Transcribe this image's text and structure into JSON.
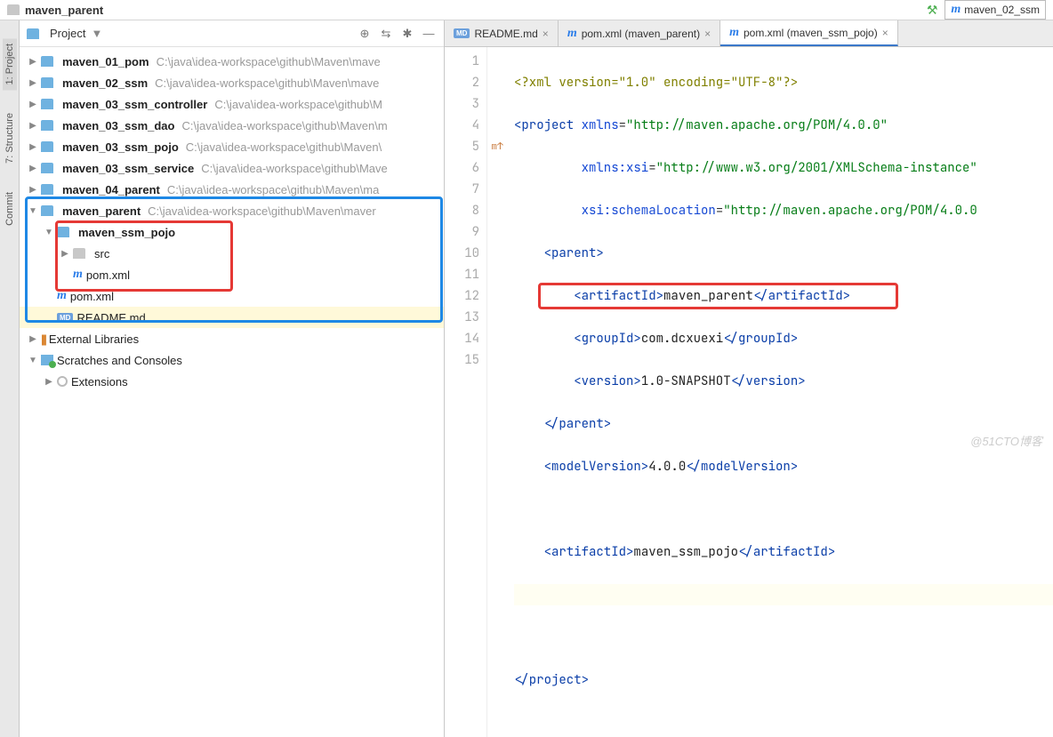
{
  "breadcrumb": {
    "folder": "maven_parent"
  },
  "run_config": "maven_02_ssm",
  "panel": {
    "title": "Project"
  },
  "tree": {
    "items": [
      {
        "name": "maven_01_pom",
        "path": "C:\\java\\idea-workspace\\github\\Maven\\mave",
        "bold": true
      },
      {
        "name": "maven_02_ssm",
        "path": "C:\\java\\idea-workspace\\github\\Maven\\mave",
        "bold": true
      },
      {
        "name": "maven_03_ssm_controller",
        "path": "C:\\java\\idea-workspace\\github\\M",
        "bold": true
      },
      {
        "name": "maven_03_ssm_dao",
        "path": "C:\\java\\idea-workspace\\github\\Maven\\m",
        "bold": true
      },
      {
        "name": "maven_03_ssm_pojo",
        "path": "C:\\java\\idea-workspace\\github\\Maven\\",
        "bold": true
      },
      {
        "name": "maven_03_ssm_service",
        "path": "C:\\java\\idea-workspace\\github\\Mave",
        "bold": true
      },
      {
        "name": "maven_04_parent",
        "path": "C:\\java\\idea-workspace\\github\\Maven\\ma",
        "bold": true
      }
    ],
    "parent": {
      "name": "maven_parent",
      "path": "C:\\java\\idea-workspace\\github\\Maven\\maver",
      "bold": true
    },
    "child_module": {
      "name": "maven_ssm_pojo",
      "bold": true
    },
    "src": "src",
    "pom_inner": "pom.xml",
    "pom_outer": "pom.xml",
    "readme": "README.md",
    "ext_lib": "External Libraries",
    "scratches": "Scratches and Consoles",
    "extensions": "Extensions"
  },
  "side_tabs": {
    "project": "1: Project",
    "structure": "7: Structure",
    "commit": "Commit"
  },
  "tabs": [
    {
      "label": "README.md",
      "icon": "md"
    },
    {
      "label": "pom.xml (maven_parent)",
      "icon": "m"
    },
    {
      "label": "pom.xml (maven_ssm_pojo)",
      "icon": "m",
      "active": true,
      "pinned": true
    }
  ],
  "code": {
    "l1": {
      "pi": "<?xml version=\"1.0\" encoding=\"UTF-8\"?>"
    },
    "l2": {
      "a": "<project ",
      "b": "xmlns",
      "c": "=",
      "d": "\"http://maven.apache.org/POM/4.0.0\""
    },
    "l3": {
      "a": "xmlns:xsi",
      "b": "=",
      "c": "\"http://www.w3.org/2001/XMLSchema-instance\""
    },
    "l4": {
      "a": "xsi:schemaLocation",
      "b": "=",
      "c": "\"http://maven.apache.org/POM/4.0.0"
    },
    "l5": {
      "a": "<parent>"
    },
    "l6": {
      "a": "<artifactId>",
      "b": "maven_parent",
      "c": "</artifactId>"
    },
    "l7": {
      "a": "<groupId>",
      "b": "com.dcxuexi",
      "c": "</groupId>"
    },
    "l8": {
      "a": "<version>",
      "b": "1.0-SNAPSHOT",
      "c": "</version>"
    },
    "l9": {
      "a": "</parent>"
    },
    "l10": {
      "a": "<modelVersion>",
      "b": "4.0.0",
      "c": "</modelVersion>"
    },
    "l12": {
      "a": "<artifactId>",
      "b": "maven_ssm_pojo",
      "c": "</artifactId>"
    },
    "l15": {
      "a": "</project>"
    }
  },
  "gutter_mark": "m↑",
  "watermark": "@51CTO博客"
}
